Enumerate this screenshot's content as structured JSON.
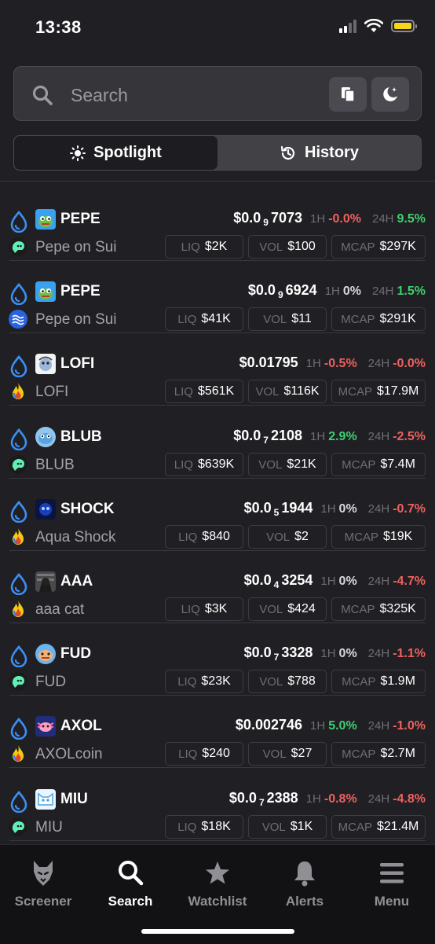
{
  "status": {
    "time": "13:38"
  },
  "search": {
    "placeholder": "Search"
  },
  "segments": [
    {
      "label": "Spotlight",
      "icon": "sun-icon",
      "active": true
    },
    {
      "label": "History",
      "icon": "history-icon",
      "active": false
    }
  ],
  "labels": {
    "h1": "1H",
    "h24": "24H",
    "liq": "LIQ",
    "vol": "VOL",
    "mcap": "MCAP"
  },
  "tokens": [
    {
      "symbol": "PEPE",
      "name": "Pepe on Sui",
      "price_pre": "$0.0",
      "price_zeros": "9",
      "price_post": "7073",
      "ch1h": "-0.0%",
      "ch1h_dir": "neg",
      "ch24h": "9.5%",
      "ch24h_dir": "pos",
      "liq": "$2K",
      "vol": "$100",
      "mcap": "$297K",
      "dex": "green-dex",
      "logo": "pepe-logo"
    },
    {
      "symbol": "PEPE",
      "name": "Pepe on Sui",
      "price_pre": "$0.0",
      "price_zeros": "9",
      "price_post": "6924",
      "ch1h": "0%",
      "ch1h_dir": "neu",
      "ch24h": "1.5%",
      "ch24h_dir": "pos",
      "liq": "$41K",
      "vol": "$11",
      "mcap": "$291K",
      "dex": "blue-dex",
      "logo": "pepe-logo"
    },
    {
      "symbol": "LOFI",
      "name": "LOFI",
      "price_pre": "$0.01795",
      "price_zeros": "",
      "price_post": "",
      "ch1h": "-0.5%",
      "ch1h_dir": "neg",
      "ch24h": "-0.0%",
      "ch24h_dir": "neg",
      "liq": "$561K",
      "vol": "$116K",
      "mcap": "$17.9M",
      "dex": "flame-dex",
      "logo": "lofi-logo"
    },
    {
      "symbol": "BLUB",
      "name": "BLUB",
      "price_pre": "$0.0",
      "price_zeros": "7",
      "price_post": "2108",
      "ch1h": "2.9%",
      "ch1h_dir": "pos",
      "ch24h": "-2.5%",
      "ch24h_dir": "neg",
      "liq": "$639K",
      "vol": "$21K",
      "mcap": "$7.4M",
      "dex": "green-dex",
      "logo": "blub-logo"
    },
    {
      "symbol": "SHOCK",
      "name": "Aqua Shock",
      "price_pre": "$0.0",
      "price_zeros": "5",
      "price_post": "1944",
      "ch1h": "0%",
      "ch1h_dir": "neu",
      "ch24h": "-0.7%",
      "ch24h_dir": "neg",
      "liq": "$840",
      "vol": "$2",
      "mcap": "$19K",
      "dex": "flame-dex",
      "logo": "shock-logo"
    },
    {
      "symbol": "AAA",
      "name": "aaa cat",
      "price_pre": "$0.0",
      "price_zeros": "4",
      "price_post": "3254",
      "ch1h": "0%",
      "ch1h_dir": "neu",
      "ch24h": "-4.7%",
      "ch24h_dir": "neg",
      "liq": "$3K",
      "vol": "$424",
      "mcap": "$325K",
      "dex": "flame-dex",
      "logo": "aaa-logo"
    },
    {
      "symbol": "FUD",
      "name": "FUD",
      "price_pre": "$0.0",
      "price_zeros": "7",
      "price_post": "3328",
      "ch1h": "0%",
      "ch1h_dir": "neu",
      "ch24h": "-1.1%",
      "ch24h_dir": "neg",
      "liq": "$23K",
      "vol": "$788",
      "mcap": "$1.9M",
      "dex": "green-dex",
      "logo": "fud-logo"
    },
    {
      "symbol": "AXOL",
      "name": "AXOLcoin",
      "price_pre": "$0.002746",
      "price_zeros": "",
      "price_post": "",
      "ch1h": "5.0%",
      "ch1h_dir": "pos",
      "ch24h": "-1.0%",
      "ch24h_dir": "neg",
      "liq": "$240",
      "vol": "$27",
      "mcap": "$2.7M",
      "dex": "flame-dex",
      "logo": "axol-logo"
    },
    {
      "symbol": "MIU",
      "name": "MIU",
      "price_pre": "$0.0",
      "price_zeros": "7",
      "price_post": "2388",
      "ch1h": "-0.8%",
      "ch1h_dir": "neg",
      "ch24h": "-4.8%",
      "ch24h_dir": "neg",
      "liq": "$18K",
      "vol": "$1K",
      "mcap": "$21.4M",
      "dex": "green-dex",
      "logo": "miu-logo"
    }
  ],
  "tabs": [
    {
      "label": "Screener",
      "icon": "wolf-icon",
      "active": false
    },
    {
      "label": "Search",
      "icon": "search-icon",
      "active": true
    },
    {
      "label": "Watchlist",
      "icon": "star-icon",
      "active": false
    },
    {
      "label": "Alerts",
      "icon": "bell-icon",
      "active": false
    },
    {
      "label": "Menu",
      "icon": "menu-icon",
      "active": false
    }
  ],
  "colors": {
    "background": "#202024",
    "positive": "#3fce6f",
    "negative": "#f0605e",
    "chain": "#3b8ff6",
    "battery": "#f6d51a"
  }
}
